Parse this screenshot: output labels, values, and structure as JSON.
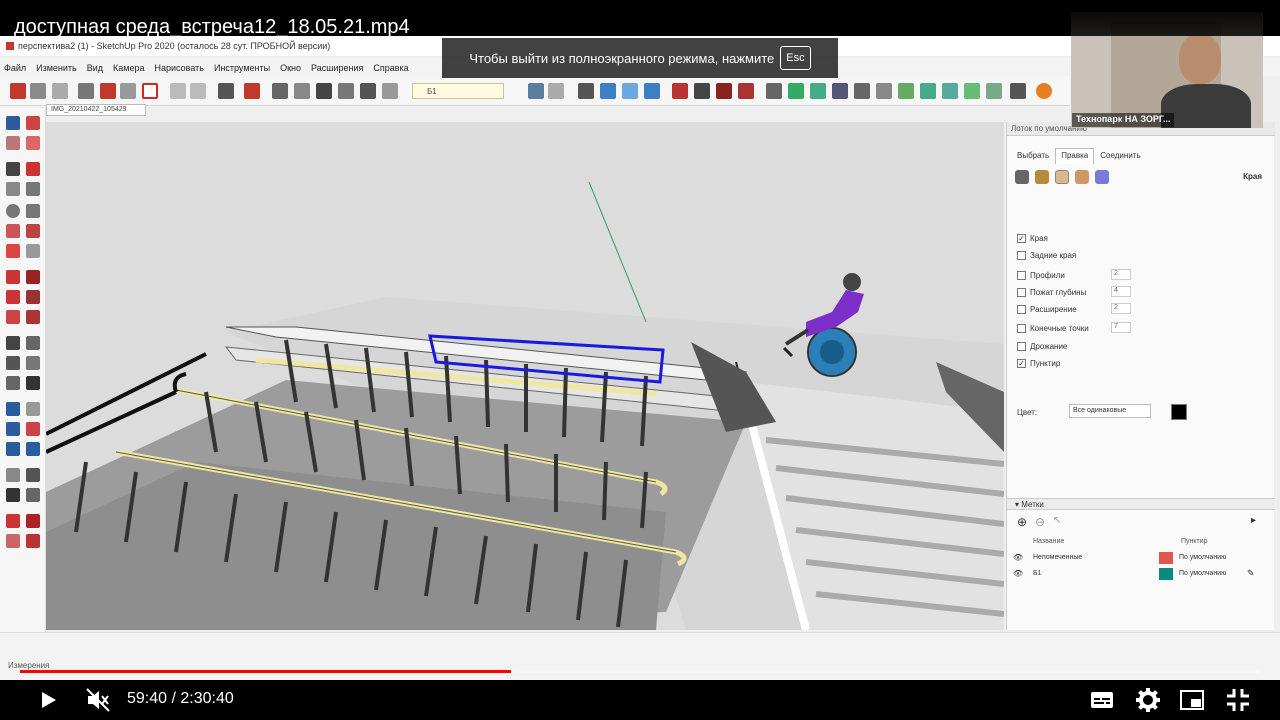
{
  "video": {
    "title": "доступная среда_встреча12_18.05.21.mp4",
    "fullscreen_hint": "Чтобы выйти из полноэкранного режима, нажмите",
    "fullscreen_key": "Esc",
    "current_time": "59:40",
    "separator": " / ",
    "duration": "2:30:40",
    "progress": 0.396
  },
  "sketchup": {
    "window_title": "перспектива2 (1) - SketchUp Pro 2020 (осталось 28 сут. ПРОБНОЙ версии)",
    "menu": [
      "Файл",
      "Изменить",
      "Вид",
      "Камера",
      "Нарисовать",
      "Инструменты",
      "Окно",
      "Расширения",
      "Справка"
    ],
    "layer_value": "Б1",
    "scene_tab": "IMG_20210422_105429",
    "status_label": "Измерения"
  },
  "tray": {
    "header": "Лоток по умолчанию",
    "tabs": [
      "Выбрать",
      "Правка",
      "Соединить"
    ],
    "active_tab": 1,
    "section_title": "Края",
    "options": [
      {
        "label": "Края",
        "checked": true
      },
      {
        "label": "Задние края",
        "checked": false
      },
      {
        "label": "Профили",
        "checked": false,
        "value": "2"
      },
      {
        "label": "Пожат глубины",
        "checked": false,
        "value": "4"
      },
      {
        "label": "Расширение",
        "checked": false,
        "value": "2"
      },
      {
        "label": "Конечные точки",
        "checked": false,
        "value": "7"
      },
      {
        "label": "Дрожание",
        "checked": false
      },
      {
        "label": "Пунктир",
        "checked": true
      }
    ],
    "color_label": "Цвет:",
    "color_select": "Все одинаковые",
    "color_swatch": "#000000",
    "tags_header": "Метки",
    "col_name": "Название",
    "col_dash": "Пунктир",
    "tags": [
      {
        "name": "Непомеченные",
        "color": "#e0574f",
        "dash": "По умолчанию"
      },
      {
        "name": "Б1",
        "color": "#0b8a80",
        "dash": "По умолчанию"
      }
    ]
  },
  "webcam": {
    "name": "Технопарк НА ЗОРГ..."
  },
  "colors": {
    "accent": "#ff0000",
    "selection": "#1a1adf",
    "handrail": "#f0e6a0"
  }
}
